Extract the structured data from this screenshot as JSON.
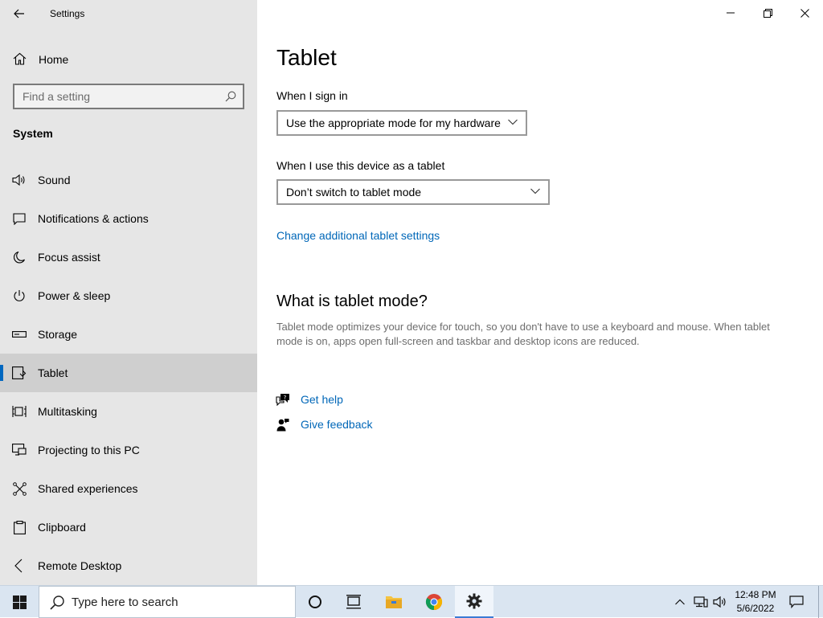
{
  "window": {
    "app_title": "Settings",
    "controls": {
      "minimize_icon": "minimize-icon",
      "restore_icon": "restore-icon",
      "close_icon": "close-icon"
    }
  },
  "sidebar": {
    "home_label": "Home",
    "search_placeholder": "Find a setting",
    "section_title": "System",
    "items": [
      {
        "label": "Sound",
        "icon": "speaker-icon",
        "active": false
      },
      {
        "label": "Notifications & actions",
        "icon": "notification-icon",
        "active": false
      },
      {
        "label": "Focus assist",
        "icon": "moon-icon",
        "active": false
      },
      {
        "label": "Power & sleep",
        "icon": "power-icon",
        "active": false
      },
      {
        "label": "Storage",
        "icon": "storage-icon",
        "active": false
      },
      {
        "label": "Tablet",
        "icon": "tablet-icon",
        "active": true
      },
      {
        "label": "Multitasking",
        "icon": "multitasking-icon",
        "active": false
      },
      {
        "label": "Projecting to this PC",
        "icon": "projecting-icon",
        "active": false
      },
      {
        "label": "Shared experiences",
        "icon": "shared-icon",
        "active": false
      },
      {
        "label": "Clipboard",
        "icon": "clipboard-icon",
        "active": false
      },
      {
        "label": "Remote Desktop",
        "icon": "remote-desktop-icon",
        "active": false
      }
    ],
    "accent_color": "#0067c0"
  },
  "main": {
    "title": "Tablet",
    "sign_in_label": "When I sign in",
    "sign_in_value": "Use the appropriate mode for my hardware",
    "tablet_use_label": "When I use this device as a tablet",
    "tablet_use_value": "Don’t switch to tablet mode",
    "additional_link": "Change additional tablet settings",
    "what_is_title": "What is tablet mode?",
    "what_is_desc": "Tablet mode optimizes your device for touch, so you don't have to use a keyboard and mouse. When tablet mode is on, apps open full-screen and taskbar and desktop icons are reduced.",
    "get_help": "Get help",
    "give_feedback": "Give feedback",
    "link_color": "#0067b8"
  },
  "taskbar": {
    "search_text": "Type here to search",
    "clock_time": "12:48 PM",
    "clock_date": "5/6/2022",
    "pinned": [
      "cortana-icon",
      "task-view-icon",
      "file-explorer-icon",
      "chrome-icon",
      "settings-icon"
    ]
  }
}
